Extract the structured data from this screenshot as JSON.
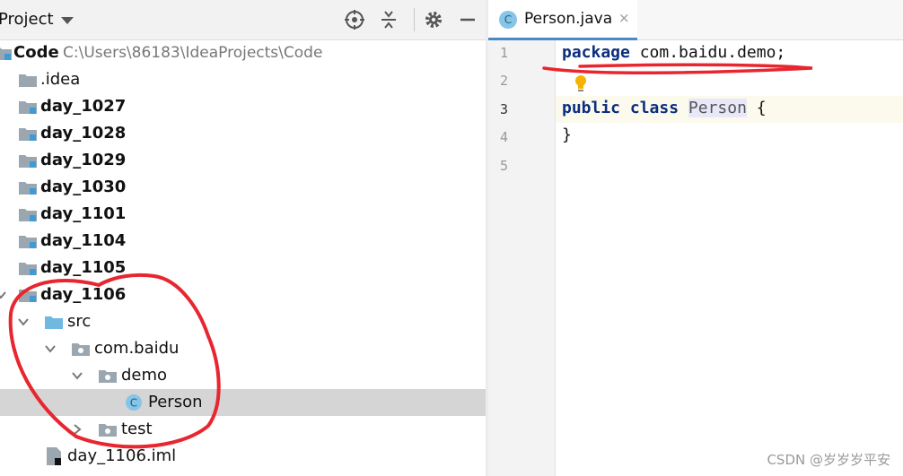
{
  "project_panel": {
    "title": "Project",
    "tree": [
      {
        "name": "Code",
        "path": "C:\\Users\\86183\\IdeaProjects\\Code"
      },
      {
        "name": ".idea"
      },
      {
        "name": "day_1027"
      },
      {
        "name": "day_1028"
      },
      {
        "name": "day_1029"
      },
      {
        "name": "day_1030"
      },
      {
        "name": "day_1101"
      },
      {
        "name": "day_1104"
      },
      {
        "name": "day_1105"
      },
      {
        "name": "day_1106"
      },
      {
        "name": "src"
      },
      {
        "name": "com.baidu"
      },
      {
        "name": "demo"
      },
      {
        "name": "Person"
      },
      {
        "name": "test"
      },
      {
        "name": "day_1106.iml"
      }
    ]
  },
  "editor": {
    "tab": {
      "label": "Person.java",
      "icon_letter": "C",
      "close": "×"
    },
    "line_numbers": [
      "1",
      "2",
      "3",
      "4",
      "5"
    ],
    "code": {
      "l1_kw": "package",
      "l1_rest": " com.baidu.demo;",
      "l3_kw": "public class",
      "l3_class": "Person",
      "l3_rest": " {",
      "l4": "}"
    }
  },
  "watermark": "CSDN @岁岁岁平安",
  "colors": {
    "annotation_red": "#e8262f",
    "tab_underline": "#4a88c7",
    "keyword": "#0b2e7e"
  }
}
